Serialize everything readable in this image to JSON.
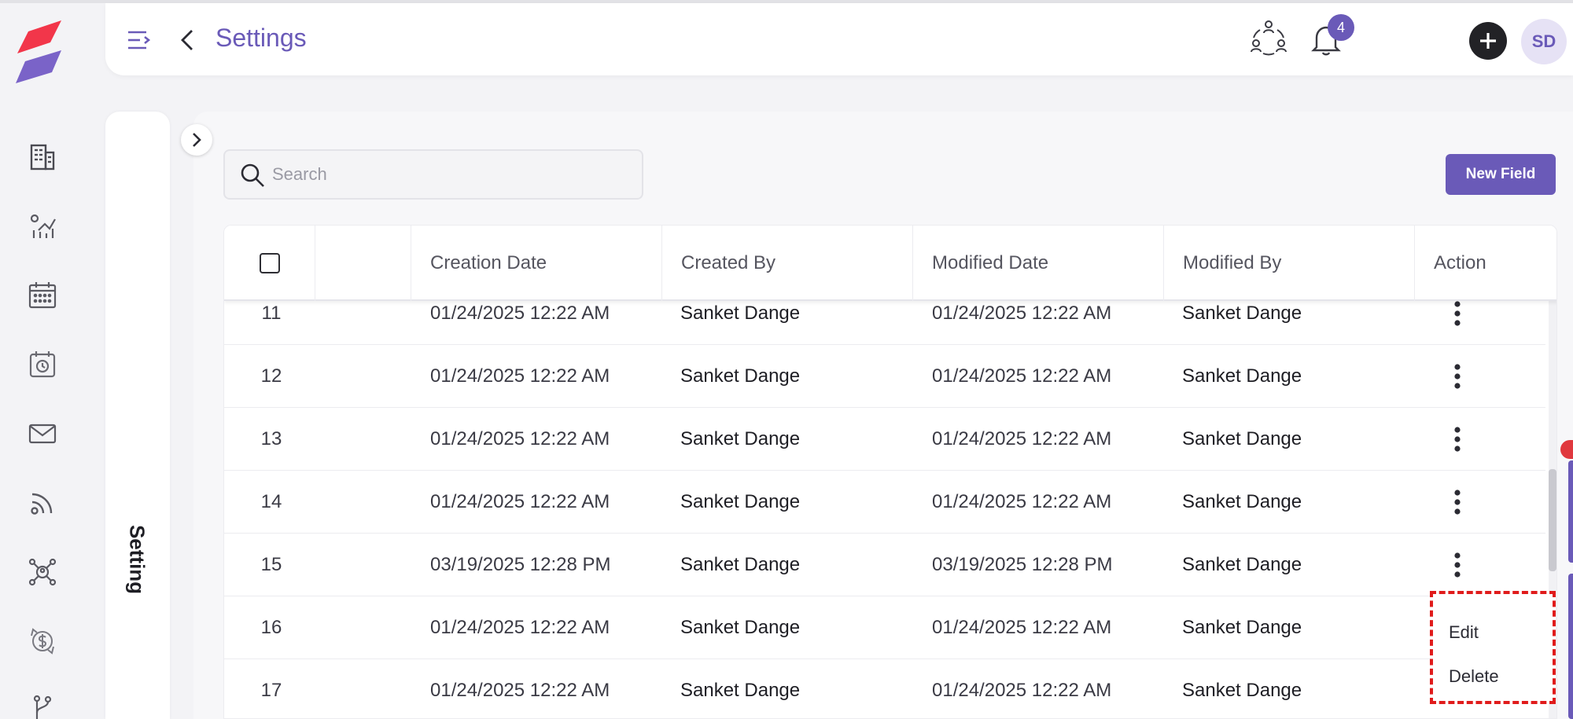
{
  "header": {
    "title": "Settings",
    "notification_count": "4",
    "avatar_initials": "SD"
  },
  "side_panel": {
    "label": "Setting"
  },
  "search": {
    "placeholder": "Search",
    "value": ""
  },
  "toolbar": {
    "new_field_label": "New Field"
  },
  "table": {
    "columns": [
      "",
      "",
      "Creation Date",
      "Created By",
      "Modified Date",
      "Modified By",
      "Action"
    ],
    "rows": [
      {
        "num": "11",
        "creation_date": "01/24/2025 12:22 AM",
        "created_by": "Sanket Dange",
        "modified_date": "01/24/2025 12:22 AM",
        "modified_by": "Sanket Dange"
      },
      {
        "num": "12",
        "creation_date": "01/24/2025 12:22 AM",
        "created_by": "Sanket Dange",
        "modified_date": "01/24/2025 12:22 AM",
        "modified_by": "Sanket Dange"
      },
      {
        "num": "13",
        "creation_date": "01/24/2025 12:22 AM",
        "created_by": "Sanket Dange",
        "modified_date": "01/24/2025 12:22 AM",
        "modified_by": "Sanket Dange"
      },
      {
        "num": "14",
        "creation_date": "01/24/2025 12:22 AM",
        "created_by": "Sanket Dange",
        "modified_date": "01/24/2025 12:22 AM",
        "modified_by": "Sanket Dange"
      },
      {
        "num": "15",
        "creation_date": "03/19/2025 12:28 PM",
        "created_by": "Sanket Dange",
        "modified_date": "03/19/2025 12:28 PM",
        "modified_by": "Sanket Dange"
      },
      {
        "num": "16",
        "creation_date": "01/24/2025 12:22 AM",
        "created_by": "Sanket Dange",
        "modified_date": "01/24/2025 12:22 AM",
        "modified_by": "Sanket Dange"
      },
      {
        "num": "17",
        "creation_date": "01/24/2025 12:22 AM",
        "created_by": "Sanket Dange",
        "modified_date": "01/24/2025 12:22 AM",
        "modified_by": "Sanket Dange"
      }
    ]
  },
  "action_menu": {
    "edit_label": "Edit",
    "delete_label": "Delete"
  },
  "rail_icons": [
    "building-icon",
    "chart-growth-icon",
    "calendar-icon",
    "clock-calendar-icon",
    "mail-icon",
    "rss-feed-icon",
    "network-icon",
    "dollar-cycle-icon",
    "branch-icon"
  ],
  "colors": {
    "accent": "#6a5ab8",
    "logo_red": "#f2364a",
    "logo_purple": "#7a63c8",
    "highlight_dashed": "#e01b1b"
  }
}
